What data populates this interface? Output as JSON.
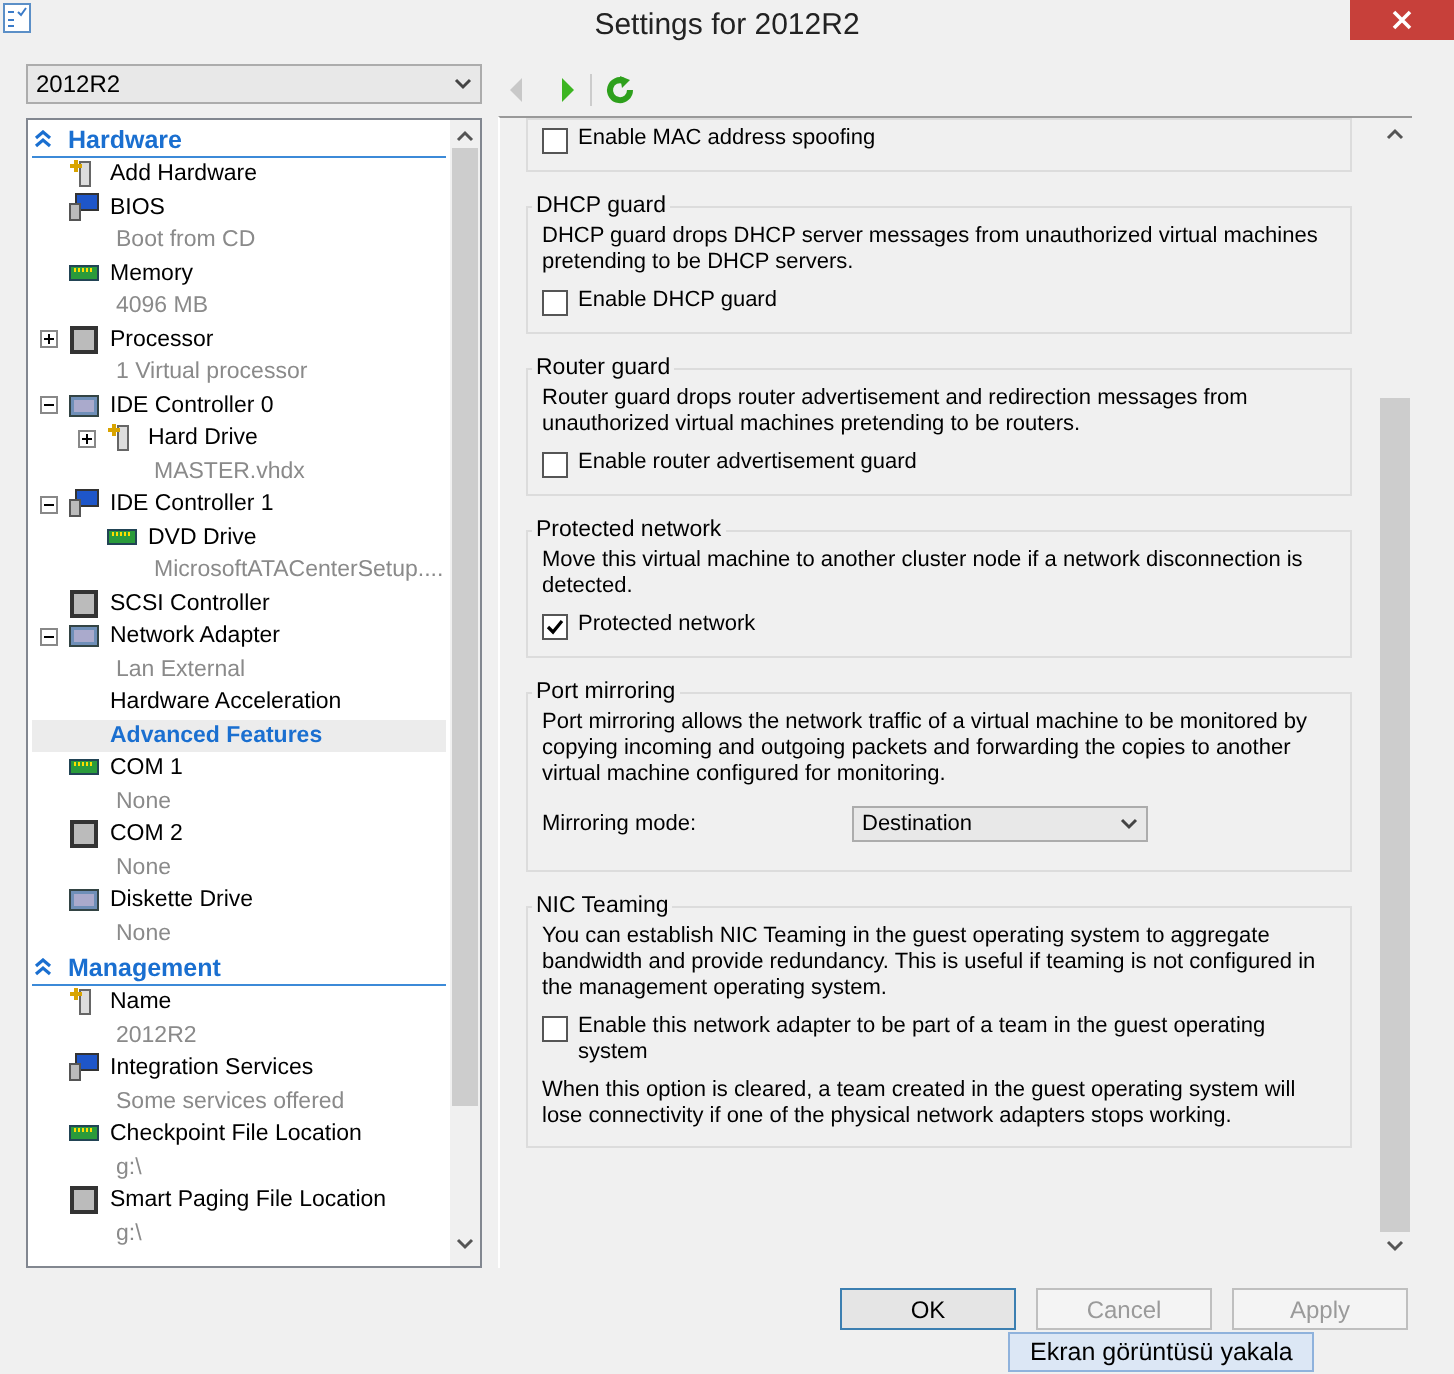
{
  "window": {
    "title": "Settings for 2012R2"
  },
  "vm_selector": {
    "value": "2012R2"
  },
  "tree": [
    {
      "title": "Hardware",
      "expanded": true,
      "items": [
        {
          "label": "Add Hardware",
          "kind": "device",
          "selected": false
        },
        {
          "label": "BIOS",
          "detail": "Boot from CD",
          "kind": "device",
          "selected": false
        },
        {
          "label": "Memory",
          "detail": "4096 MB",
          "kind": "device",
          "selected": false
        },
        {
          "label": "Processor",
          "detail": "1 Virtual processor",
          "kind": "device",
          "expanded": false,
          "selected": false
        },
        {
          "label": "IDE Controller 0",
          "kind": "device",
          "expanded": true,
          "selected": false,
          "children": [
            {
              "label": "Hard Drive",
              "detail": "MASTER.vhdx",
              "kind": "device",
              "expanded": false,
              "selected": false
            }
          ]
        },
        {
          "label": "IDE Controller 1",
          "kind": "device",
          "expanded": true,
          "selected": false,
          "children": [
            {
              "label": "DVD Drive",
              "detail": "MicrosoftATACenterSetup....",
              "kind": "device",
              "selected": false
            }
          ]
        },
        {
          "label": "SCSI Controller",
          "kind": "device",
          "selected": false
        },
        {
          "label": "Network Adapter",
          "detail": "Lan External",
          "kind": "device",
          "expanded": true,
          "selected": false,
          "children": [
            {
              "label": "Hardware Acceleration",
              "kind": "page",
              "selected": false
            },
            {
              "label": "Advanced Features",
              "kind": "page",
              "selected": true
            }
          ]
        },
        {
          "label": "COM 1",
          "detail": "None",
          "kind": "device",
          "selected": false
        },
        {
          "label": "COM 2",
          "detail": "None",
          "kind": "device",
          "selected": false
        },
        {
          "label": "Diskette Drive",
          "detail": "None",
          "kind": "device",
          "selected": false
        }
      ]
    },
    {
      "title": "Management",
      "expanded": true,
      "items": [
        {
          "label": "Name",
          "detail": "2012R2",
          "kind": "device",
          "selected": false
        },
        {
          "label": "Integration Services",
          "detail": "Some services offered",
          "kind": "device",
          "selected": false
        },
        {
          "label": "Checkpoint File Location",
          "detail": "g:\\",
          "kind": "device",
          "selected": false
        },
        {
          "label": "Smart Paging File Location",
          "detail": "g:\\",
          "kind": "device",
          "selected": false
        }
      ]
    }
  ],
  "groups": [
    {
      "controls": [
        {
          "kind": "checkbox",
          "label": "Enable MAC address spoofing",
          "checked": false
        }
      ]
    },
    {
      "title": "DHCP guard",
      "description": "DHCP guard drops DHCP server messages from unauthorized virtual machines pretending to be DHCP servers.",
      "controls": [
        {
          "kind": "checkbox",
          "label": "Enable DHCP guard",
          "checked": false
        }
      ]
    },
    {
      "title": "Router guard",
      "description": "Router guard drops router advertisement and redirection messages from unauthorized virtual machines pretending to be routers.",
      "controls": [
        {
          "kind": "checkbox",
          "label": "Enable router advertisement guard",
          "checked": false
        }
      ]
    },
    {
      "title": "Protected network",
      "description": "Move this virtual machine to another cluster node if a network disconnection is detected.",
      "controls": [
        {
          "kind": "checkbox",
          "label": "Protected network",
          "checked": true
        }
      ]
    },
    {
      "title": "Port mirroring",
      "description": "Port mirroring allows the network traffic of a virtual machine to be monitored by copying incoming and outgoing packets and forwarding the copies to another virtual machine configured for monitoring.",
      "controls": [
        {
          "kind": "select",
          "label": "Mirroring mode:",
          "value": "Destination"
        }
      ]
    },
    {
      "title": "NIC Teaming",
      "description": "You can establish NIC Teaming in the guest operating system to aggregate bandwidth and provide redundancy. This is useful if teaming is not configured in the management operating system.",
      "controls": [
        {
          "kind": "checkbox",
          "label": "Enable this network adapter to be part of a team in the guest operating system",
          "checked": false
        }
      ],
      "note": "When this option is cleared, a team created in the guest operating system will lose connectivity if one of the physical network adapters stops working."
    }
  ],
  "buttons": [
    {
      "label": "OK",
      "disabled": false
    },
    {
      "label": "Cancel",
      "disabled": true
    },
    {
      "label": "Apply",
      "disabled": true
    }
  ],
  "tooltip": {
    "text": "Ekran görüntüsü yakala"
  }
}
